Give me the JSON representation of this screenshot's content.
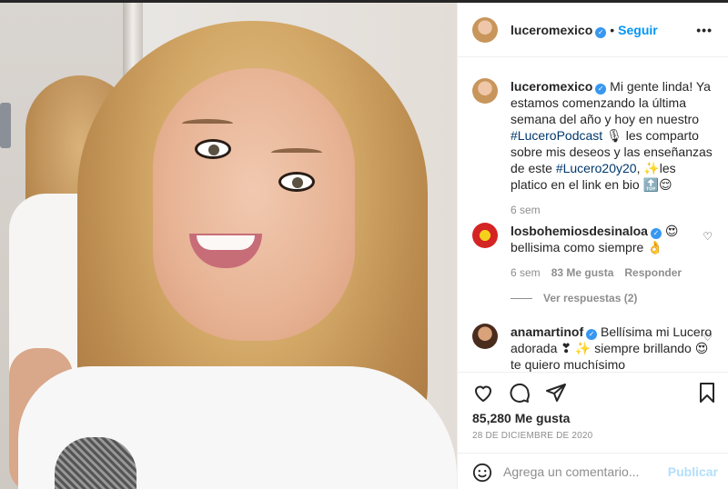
{
  "post": {
    "username": "luceromexico",
    "follow_label": "Seguir",
    "separator": "•",
    "more_label": "•••"
  },
  "caption": {
    "username": "luceromexico",
    "text_1": " Mi gente linda! Ya estamos comenzando la última semana del año y hoy en nuestro ",
    "tag_1": "#LuceroPodcast",
    "text_2": " 🎙 les comparto sobre mis deseos y las enseñanzas de este ",
    "tag_2": "#Lucero20y20",
    "text_3": ", ✨les platico en el link en bio 🔝😌",
    "time": "6 sem"
  },
  "comments": [
    {
      "username": "losbohemiosdesinaloa",
      "emoji": " 😍",
      "text": "bellisima como siempre 👌",
      "time": "6 sem",
      "likes": "83 Me gusta",
      "reply": "Responder",
      "view_replies": "Ver respuestas (2)"
    },
    {
      "username": "anamartinof",
      "text": " Bellísima mi Lucero adorada ❣ ✨ siempre brillando 😍 te quiero muchísimo"
    }
  ],
  "actions": {
    "likes": "85,280 Me gusta",
    "date": "28 DE DICIEMBRE DE 2020"
  },
  "add_comment": {
    "placeholder": "Agrega un comentario...",
    "post_label": "Publicar"
  },
  "colors": {
    "link": "#0095f6",
    "verified": "#3897f0",
    "muted": "#8e8e8e",
    "post_disabled": "#b2dffc"
  },
  "icons": [
    "verified-badge-icon",
    "more-options-icon",
    "heart-icon",
    "comment-icon",
    "share-icon",
    "bookmark-icon",
    "emoji-icon"
  ]
}
